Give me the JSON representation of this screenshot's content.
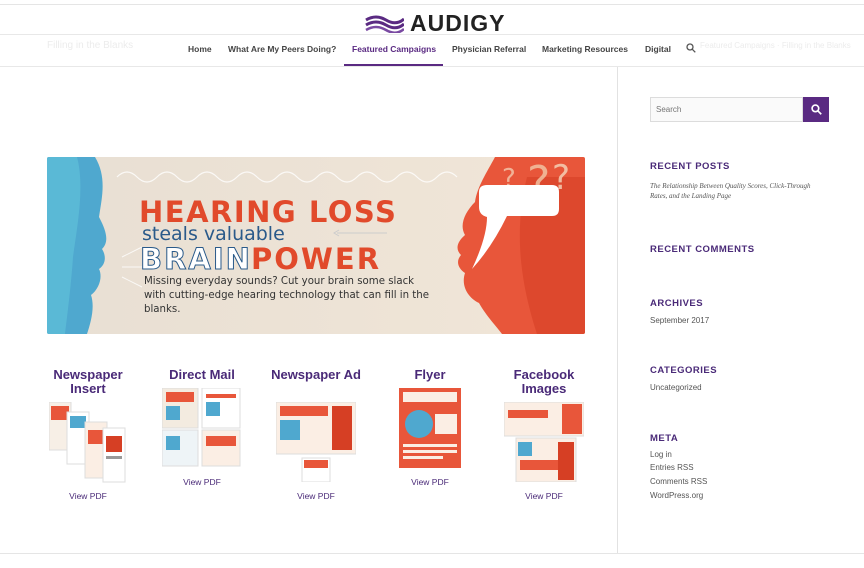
{
  "logo": {
    "word": "AUDIGY"
  },
  "ghost": {
    "left": "Filling in the Blanks",
    "right": "Featured Campaigns · Filling in the Blanks"
  },
  "nav": {
    "items": [
      "Home",
      "What Are My Peers Doing?",
      "Featured Campaigns",
      "Physician Referral",
      "Marketing Resources",
      "Digital"
    ],
    "active": "Featured Campaigns"
  },
  "banner": {
    "line1": "HEARING LOSS",
    "line2": "steals valuable",
    "line3a": "BRAIN",
    "line3b": "POWER",
    "body": "Missing everyday sounds? Cut your brain some slack with cutting-edge hearing technology that can fill in the blanks."
  },
  "products": [
    {
      "title": "Newspaper Insert",
      "link": "View PDF"
    },
    {
      "title": "Direct Mail",
      "link": "View PDF"
    },
    {
      "title": "Newspaper Ad",
      "link": "View PDF"
    },
    {
      "title": "Flyer",
      "link": "View PDF"
    },
    {
      "title": "Facebook Images",
      "link": "View PDF"
    }
  ],
  "sidebar": {
    "search_placeholder": "Search",
    "recent_posts_title": "RECENT POSTS",
    "recent_post": "The Relationship Between Quality Scores, Click-Through Rates, and the Landing Page",
    "recent_comments_title": "RECENT COMMENTS",
    "archives_title": "ARCHIVES",
    "archive_item": "September 2017",
    "categories_title": "CATEGORIES",
    "category_item": "Uncategorized",
    "meta_title": "META",
    "meta_items": [
      "Log in",
      "Entries RSS",
      "Comments RSS",
      "WordPress.org"
    ]
  },
  "colors": {
    "brand": "#5a2a82",
    "accent": "#e14a2b"
  }
}
